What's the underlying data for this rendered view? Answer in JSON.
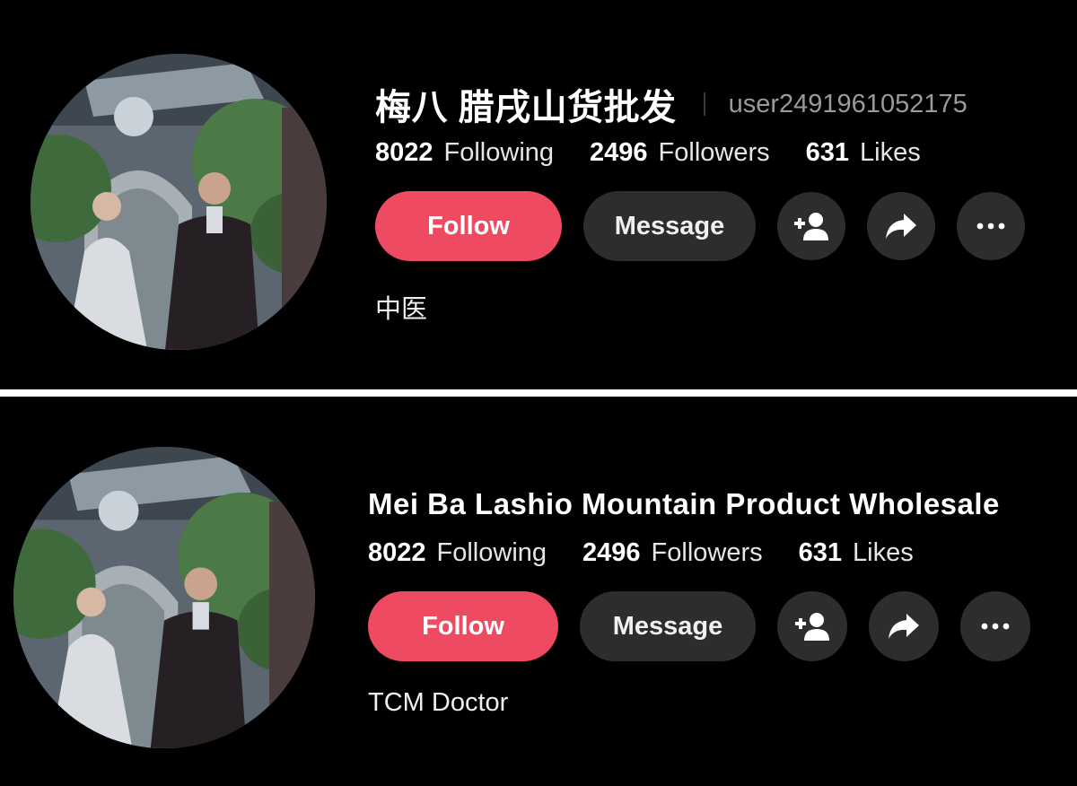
{
  "profiles": [
    {
      "display_name": "梅八 腊戌山货批发",
      "username": "user2491961052175",
      "following_count": "8022",
      "following_label": "Following",
      "followers_count": "2496",
      "followers_label": "Followers",
      "likes_count": "631",
      "likes_label": "Likes",
      "follow_label": "Follow",
      "message_label": "Message",
      "bio": "中医"
    },
    {
      "display_name": "Mei Ba Lashio Mountain Product Wholesale",
      "following_count": "8022",
      "following_label": "Following",
      "followers_count": "2496",
      "followers_label": "Followers",
      "likes_count": "631",
      "likes_label": "Likes",
      "follow_label": "Follow",
      "message_label": "Message",
      "bio": "TCM Doctor"
    }
  ],
  "icons": {
    "add_friend": "add-friend-icon",
    "share": "share-arrow-icon",
    "more": "more-dots-icon"
  },
  "colors": {
    "background": "#000000",
    "follow_button": "#ee4a62",
    "secondary_button": "#2d2d2d",
    "username_text": "#9a9a9a",
    "divider": "#ffffff"
  }
}
